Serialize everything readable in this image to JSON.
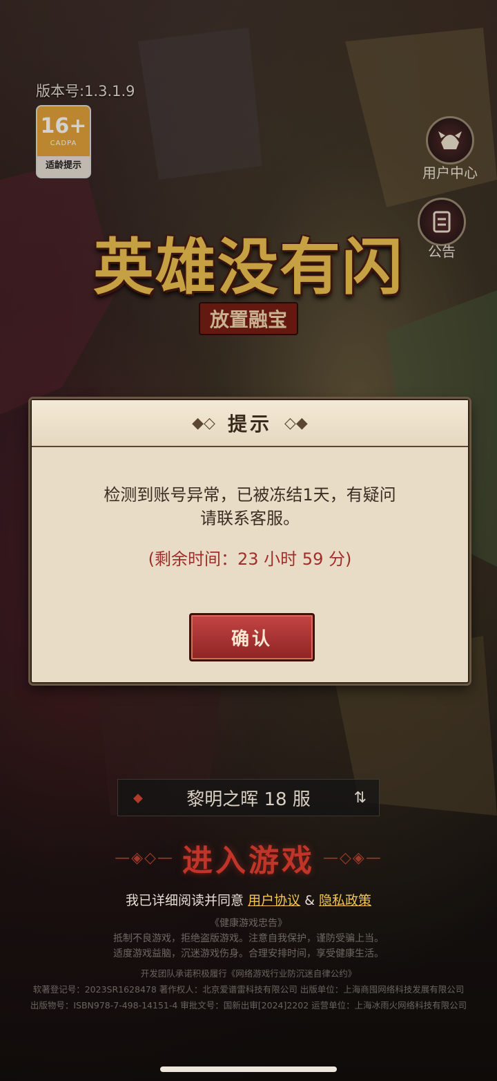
{
  "header": {
    "version": "版本号:1.3.1.9",
    "age_rating": {
      "number": "16+",
      "org": "CADPA",
      "label": "适龄提示"
    },
    "user_center": {
      "label": "用户中心",
      "icon": "helmet-icon"
    },
    "notice": {
      "label": "公告",
      "icon": "scroll-icon"
    }
  },
  "logo": {
    "title": "英雄没有闪",
    "subtitle": "放置融宝"
  },
  "dialog": {
    "title": "提示",
    "message_line1": "检测到账号异常，已被冻结1天，有疑问",
    "message_line2": "请联系客服。",
    "remaining": "(剩余时间：23 小时 59 分)",
    "confirm_label": "确认"
  },
  "server": {
    "name": "黎明之晖 18 服"
  },
  "enter": {
    "label": "进入游戏"
  },
  "agreement": {
    "prefix": "我已详细阅读并同意",
    "user_agreement": "用户协议",
    "and": "&",
    "privacy": "隐私政策"
  },
  "health_notice": {
    "title": "《健康游戏忠告》",
    "line1": "抵制不良游戏，拒绝盗版游戏。注意自我保护，谨防受骗上当。",
    "line2": "适度游戏益脑，沉迷游戏伤身。合理安排时间，享受健康生活。"
  },
  "legal": {
    "line1": "开发团队承诺积极履行《网络游戏行业防沉迷自律公约》",
    "line2": "软著登记号：2023SR1628478  著作权人：北京爱谱雷科技有限公司  出版单位：上海商囤网络科技发展有限公司",
    "line3": "出版物号：ISBN978-7-498-14151-4 审批文号：国新出审[2024]2202 运营单位：上海冰雨火网络科技有限公司"
  },
  "colors": {
    "accent_gold": "#f2c552",
    "danger_red": "#9e2e2b",
    "button_red": "#b23a3a"
  }
}
